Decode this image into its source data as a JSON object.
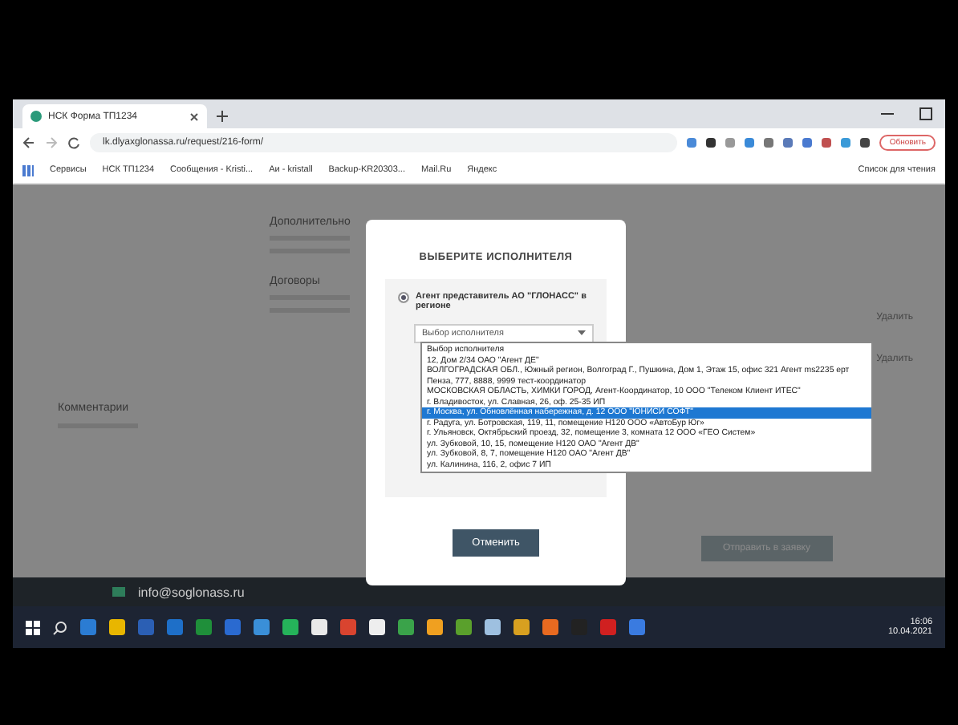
{
  "browser": {
    "tab_title": "НСК Форма ТП1234",
    "url": "lk.dlyaxglonassa.ru/request/216-form/",
    "profile_button": "Обновить",
    "bookmarks": [
      "Сервисы",
      "НСК ТП1234",
      "Сообщения - Kristi...",
      "Аи - kristall",
      "Backup-KR20303...",
      "Mail.Ru",
      "Яндекс"
    ],
    "reading_list": "Список для чтения"
  },
  "page": {
    "sections": [
      "Дополнительно",
      "Договоры"
    ],
    "comment_title": "Комментарии",
    "delete_links": [
      "Удалить",
      "Удалить"
    ],
    "submit_button": "Отправить в заявку"
  },
  "modal": {
    "title": "ВЫБЕРИТЕ ИСПОЛНИТЕЛЯ",
    "option": {
      "label": "Агент представитель АО \"ГЛОНАСС\" в регионе",
      "selected": true
    },
    "select_value": "Выбор исполнителя",
    "dropdown": [
      {
        "text": "Выбор исполнителя",
        "selected": false
      },
      {
        "text": "12, Дом 2/34 ОАО \"Агент ДЕ\"",
        "selected": false
      },
      {
        "text": "ВОЛГОГРАДСКАЯ ОБЛ., Южный регион, Волгоград Г., Пушкина, Дом 1, Этаж 15, офис 321 Агент ms2235 ерт",
        "selected": false
      },
      {
        "text": "Пенза, 777, 8888, 9999 тест-координатор",
        "selected": false
      },
      {
        "text": "МОСКОВСКАЯ ОБЛАСТЬ, ХИМКИ ГОРОД, Агент-Координатор, 10 ООО \"Телеком Клиент ИТЕС\"",
        "selected": false
      },
      {
        "text": "г. Владивосток, ул. Славная, 26, оф. 25-35 ИП",
        "selected": false
      },
      {
        "text": "г. Москва, ул. Обновлённая набережная, д. 12 ООО \"ЮНИСИ СОФТ\"",
        "selected": true
      },
      {
        "text": "г. Радуга, ул. Ботровская, 119, 11, помещение Н120 ООО «АвтоБур Юг»",
        "selected": false
      },
      {
        "text": "г. Ульяновск, Октябрьский проезд, 32, помещение 3, комната 12 ООО «ГЕО Систем»",
        "selected": false
      },
      {
        "text": "ул. Зубковой, 10, 15, помещение Н120 ОАО \"Агент ДВ\"",
        "selected": false
      },
      {
        "text": "ул. Зубковой, 8, 7, помещение Н120 ОАО \"Агент ДВ\"",
        "selected": false
      },
      {
        "text": "ул. Калинина, 116, 2, офис 7 ИП",
        "selected": false
      }
    ],
    "cancel_button": "Отменить"
  },
  "footer": {
    "email": "info@soglonass.ru"
  },
  "taskbar": {
    "time": "16:06",
    "date": "10.04.2021"
  }
}
